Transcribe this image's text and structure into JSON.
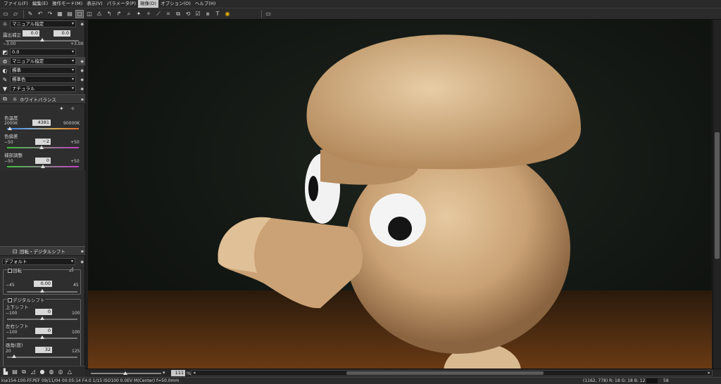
{
  "menu": [
    "ファイル(F)",
    "編集(E)",
    "操作モード(M)",
    "表示(V)",
    "パラメータ(P)",
    "現像(D)",
    "オプション(O)",
    "ヘルプ(H)"
  ],
  "active_menu_index": 5,
  "toolbar_icons": [
    "open-icon",
    "folder-icon",
    "tool-icon",
    "undo-icon",
    "redo-icon",
    "grid-view-icon",
    "filmstrip-view-icon",
    "single-view-icon",
    "compare-view-icon",
    "warning-icon",
    "rotate-left-icon",
    "rotate-right-icon",
    "zoom-icon",
    "wb-picker-icon",
    "eyedropper-icon",
    "brush-icon",
    "crop-icon",
    "digital-shift-icon",
    "undo-edit-icon",
    "checkbox-icon",
    "batch-icon",
    "text-icon",
    "develop-icon"
  ],
  "panel": {
    "exposure": {
      "mode": "マニュアル指定",
      "label": "露出補正",
      "value": "0.0",
      "value2": "0.0",
      "min": "−3.00",
      "max": "+3.00",
      "level_fraction": 0.5
    },
    "tone": {
      "value": "0.0"
    },
    "contrast_mode": "マニュアル指定",
    "contrast_preset": "標準",
    "color_preset": "標準色",
    "finish_preset": "ナチュラル",
    "wb": {
      "title": "ホワイトバランス",
      "temp_label": "色温度",
      "temp_min": "2000K",
      "temp_value": "4381",
      "temp_max": "90000K",
      "temp_fraction": 0.04,
      "tint_label": "色偏差",
      "tint_min": "−50",
      "tint_value": "−2",
      "tint_max": "+50",
      "tint_fraction": 0.48,
      "fine_label": "補部調整",
      "fine_min": "−50",
      "fine_value": "0",
      "fine_max": "+50",
      "fine_fraction": 0.5
    },
    "rotate": {
      "title": "回転・デジタルシフト",
      "preset": "デフォルト",
      "rotate_label": "回転",
      "rot_min": "−45",
      "rot_value": "0.00",
      "rot_max": "45",
      "rot_fraction": 0.5,
      "shift_label": "デジタルシフト",
      "vshift_label": "上下シフト",
      "vshift_min": "−100",
      "vshift_value": "0",
      "vshift_max": "100",
      "vshift_fraction": 0.5,
      "hshift_label": "左右シフト",
      "hshift_min": "−100",
      "hshift_value": "0",
      "hshift_max": "100",
      "hshift_fraction": 0.5,
      "angle_label": "画角(度)",
      "angle_min": "20",
      "angle_value": "32",
      "angle_max": "125",
      "angle_fraction": 0.1
    }
  },
  "zoom": {
    "value": "111",
    "unit": "%"
  },
  "status": {
    "left": "k\\e154-100-FF.PEF 09/11/04 00:05:14 F4.0 1/15 ISO100 0.0EV M(Center) f=50.0mm",
    "right": "(1162, 778) R: 18 G: 18 B: 12",
    "extra": "58"
  }
}
